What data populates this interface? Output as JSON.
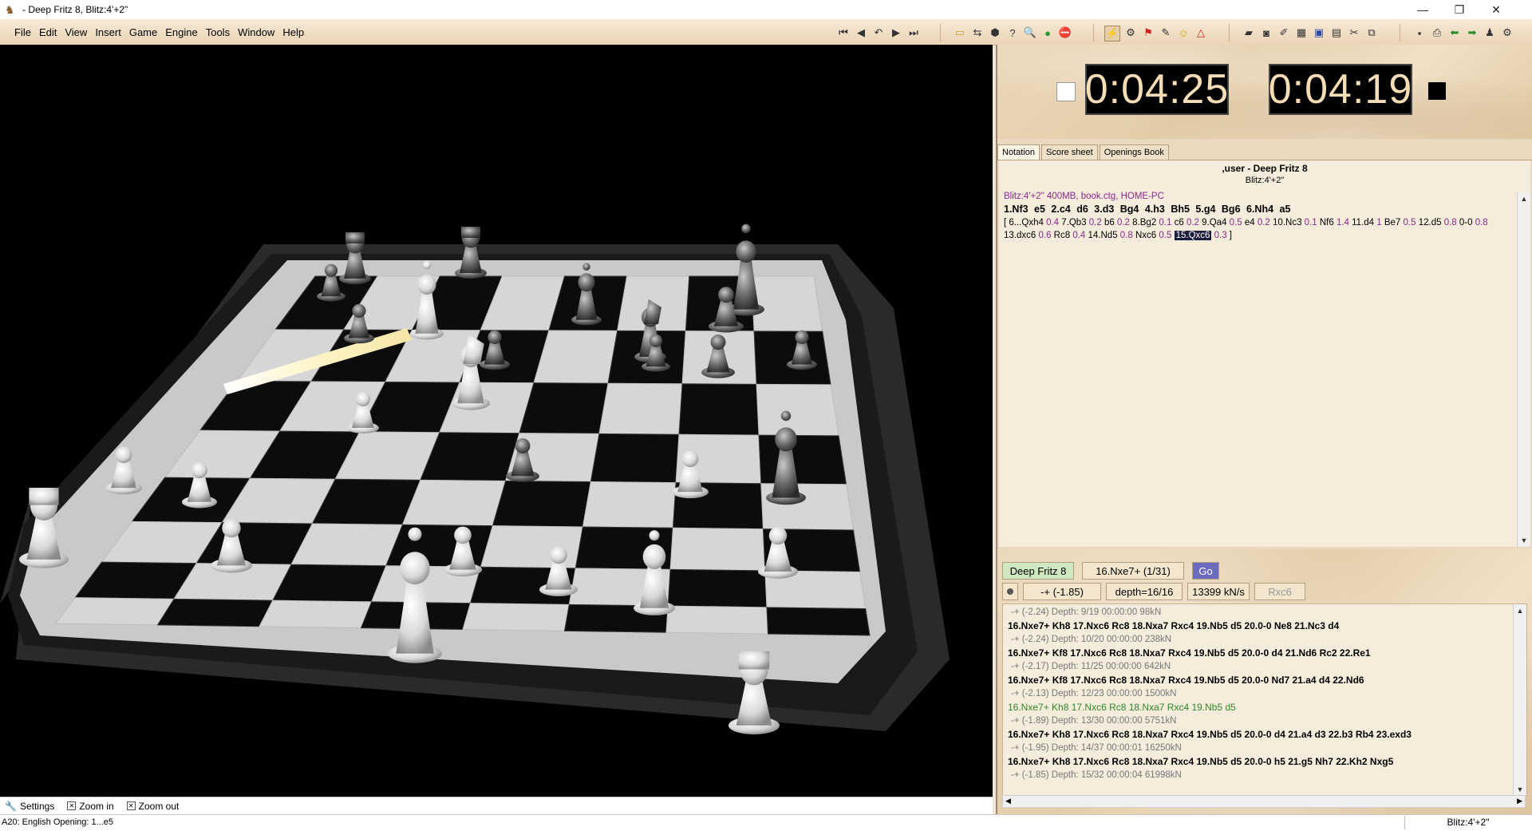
{
  "window": {
    "title": "- Deep Fritz 8, Blitz:4'+2\"",
    "min": "—",
    "restore": "❐",
    "close": "✕"
  },
  "menu": [
    "File",
    "Edit",
    "View",
    "Insert",
    "Game",
    "Engine",
    "Tools",
    "Window",
    "Help"
  ],
  "clocks": {
    "white_time": "0:04:25",
    "black_time": "0:04:19"
  },
  "tabs": [
    "Notation",
    "Score sheet",
    "Openings Book"
  ],
  "notation": {
    "players": ",user - Deep Fritz 8",
    "event": "Blitz:4'+2\"",
    "info": "Blitz:4'+2\"  400MB, book.ctg, HOME-PC",
    "mainline": "1.Nf3  e5  2.c4  d6  3.d3  Bg4  4.h3  Bh5  5.g4  Bg6  6.Nh4  a5",
    "variation": [
      [
        "[ 6...Qxh4",
        "0.4"
      ],
      [
        "7.Qb3",
        "0.2"
      ],
      [
        "b6",
        "0.2"
      ],
      [
        "8.Bg2",
        "0.1"
      ],
      [
        "c6",
        "0.2"
      ],
      [
        "9.Qa4",
        "0.5"
      ],
      [
        "e4",
        "0.2"
      ],
      [
        "10.Nc3",
        "0.1"
      ],
      [
        "Nf6",
        "1.4"
      ],
      [
        "11.d4",
        "1"
      ],
      [
        "Be7",
        "0.5"
      ],
      [
        "12.d5",
        "0.8"
      ],
      [
        "0-0",
        "0.8"
      ],
      [
        "13.dxc6",
        "0.6"
      ],
      [
        "Rc8",
        "0.4"
      ],
      [
        "14.Nd5",
        "0.8"
      ],
      [
        "Nxc6",
        "0.5"
      ]
    ],
    "last_move": "15.Qxc6",
    "last_eval": "0.3",
    "close_bracket": "]"
  },
  "engine": {
    "name": "Deep Fritz 8",
    "current_move": "16.Nxe7+ (1/31)",
    "go_label": "Go",
    "eval": "-+  (-1.85)",
    "depth": "depth=16/16",
    "speed": "13399 kN/s",
    "best": "Rxc6",
    "lines": [
      {
        "kind": "info",
        "text": "-+  (-2.24)   Depth: 9/19   00:00:00  98kN"
      },
      {
        "kind": "main",
        "text": "16.Nxe7+ Kh8 17.Nxc6 Rc8 18.Nxa7 Rxc4 19.Nb5 d5 20.0-0 Ne8 21.Nc3 d4"
      },
      {
        "kind": "info",
        "text": "-+  (-2.24)   Depth: 10/20   00:00:00  238kN"
      },
      {
        "kind": "main",
        "text": "16.Nxe7+ Kf8 17.Nxc6 Rc8 18.Nxa7 Rxc4 19.Nb5 d5 20.0-0 d4 21.Nd6 Rc2 22.Re1"
      },
      {
        "kind": "info",
        "text": "-+  (-2.17)   Depth: 11/25   00:00:00  642kN"
      },
      {
        "kind": "main",
        "text": "16.Nxe7+ Kf8 17.Nxc6 Rc8 18.Nxa7 Rxc4 19.Nb5 d5 20.0-0 Nd7 21.a4 d4 22.Nd6"
      },
      {
        "kind": "info",
        "text": "-+  (-2.13)   Depth: 12/23   00:00:00  1500kN"
      },
      {
        "kind": "green",
        "text": "16.Nxe7+ Kh8 17.Nxc6 Rc8 18.Nxa7 Rxc4 19.Nb5 d5"
      },
      {
        "kind": "info",
        "text": "-+  (-1.89)   Depth: 13/30   00:00:00  5751kN"
      },
      {
        "kind": "main",
        "text": "16.Nxe7+ Kh8 17.Nxc6 Rc8 18.Nxa7 Rxc4 19.Nb5 d5 20.0-0 d4 21.a4 d3 22.b3 Rb4 23.exd3"
      },
      {
        "kind": "info",
        "text": "-+  (-1.95)   Depth: 14/37   00:00:01  16250kN"
      },
      {
        "kind": "main",
        "text": "16.Nxe7+ Kh8 17.Nxc6 Rc8 18.Nxa7 Rxc4 19.Nb5 d5 20.0-0 h5 21.g5 Nh7 22.Kh2 Nxg5"
      },
      {
        "kind": "info",
        "text": "-+  (-1.85)   Depth: 15/32   00:00:04  61998kN"
      }
    ]
  },
  "boardbar": {
    "settings": "Settings",
    "zoom_in": "Zoom in",
    "zoom_out": "Zoom out"
  },
  "status": {
    "left": "A20: English Opening: 1...e5",
    "right": "Blitz:4'+2\""
  }
}
